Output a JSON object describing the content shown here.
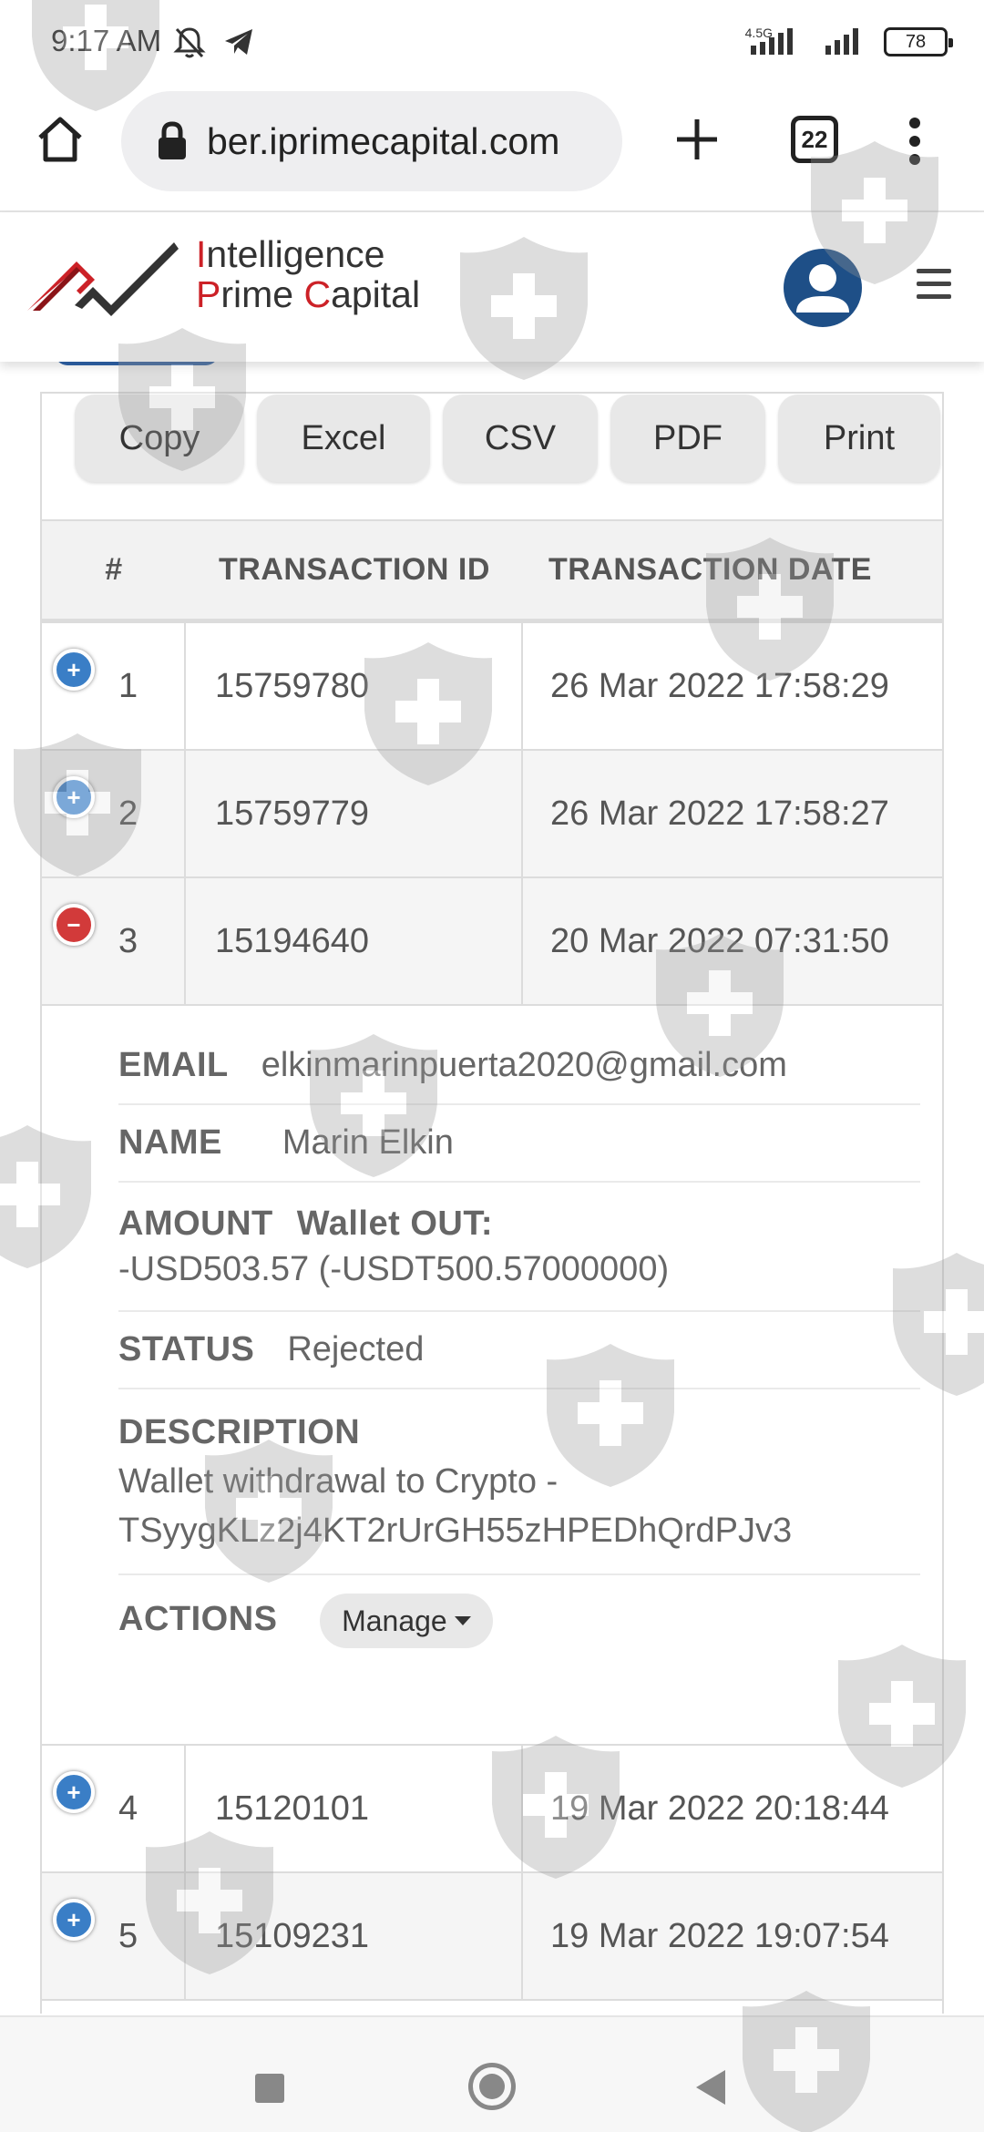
{
  "status_bar": {
    "time": "9:17 AM",
    "network": "4.5G",
    "battery": "78"
  },
  "browser": {
    "url": "ber.iprimecapital.com",
    "tab_count": "22"
  },
  "site": {
    "logo_line1_first": "I",
    "logo_line1_rest": "ntelligence",
    "logo_line2_p": "P",
    "logo_line2_rime": "rime ",
    "logo_line2_c": "C",
    "logo_line2_rest": "apital"
  },
  "export_buttons": [
    "Copy",
    "Excel",
    "CSV",
    "PDF",
    "Print"
  ],
  "table": {
    "headers": [
      "#",
      "TRANSACTION ID",
      "TRANSACTION DATE"
    ],
    "rows": [
      {
        "num": "1",
        "id": "15759780",
        "date": "26 Mar 2022 17:58:29",
        "toggle": "+"
      },
      {
        "num": "2",
        "id": "15759779",
        "date": "26 Mar 2022 17:58:27",
        "toggle": "+"
      },
      {
        "num": "3",
        "id": "15194640",
        "date": "20 Mar 2022 07:31:50",
        "toggle": "−"
      },
      {
        "num": "4",
        "id": "15120101",
        "date": "19 Mar 2022 20:18:44",
        "toggle": "+"
      },
      {
        "num": "5",
        "id": "15109231",
        "date": "19 Mar 2022 19:07:54",
        "toggle": "+"
      }
    ]
  },
  "detail": {
    "email_label": "EMAIL",
    "email": "elkinmarinpuerta2020@gmail.com",
    "name_label": "NAME",
    "name": "Marin Elkin",
    "amount_label": "AMOUNT",
    "amount_type": "Wallet OUT:",
    "amount_value": "-USD503.57 (-USDT500.57000000)",
    "status_label": "STATUS",
    "status": "Rejected",
    "description_label": "DESCRIPTION",
    "description_line1": "Wallet withdrawal to Crypto -",
    "description_line2": "TSyygKLz2j4KT2rUrGH55zHPEDhQrdPJv3",
    "actions_label": "ACTIONS",
    "manage_label": "Manage"
  }
}
